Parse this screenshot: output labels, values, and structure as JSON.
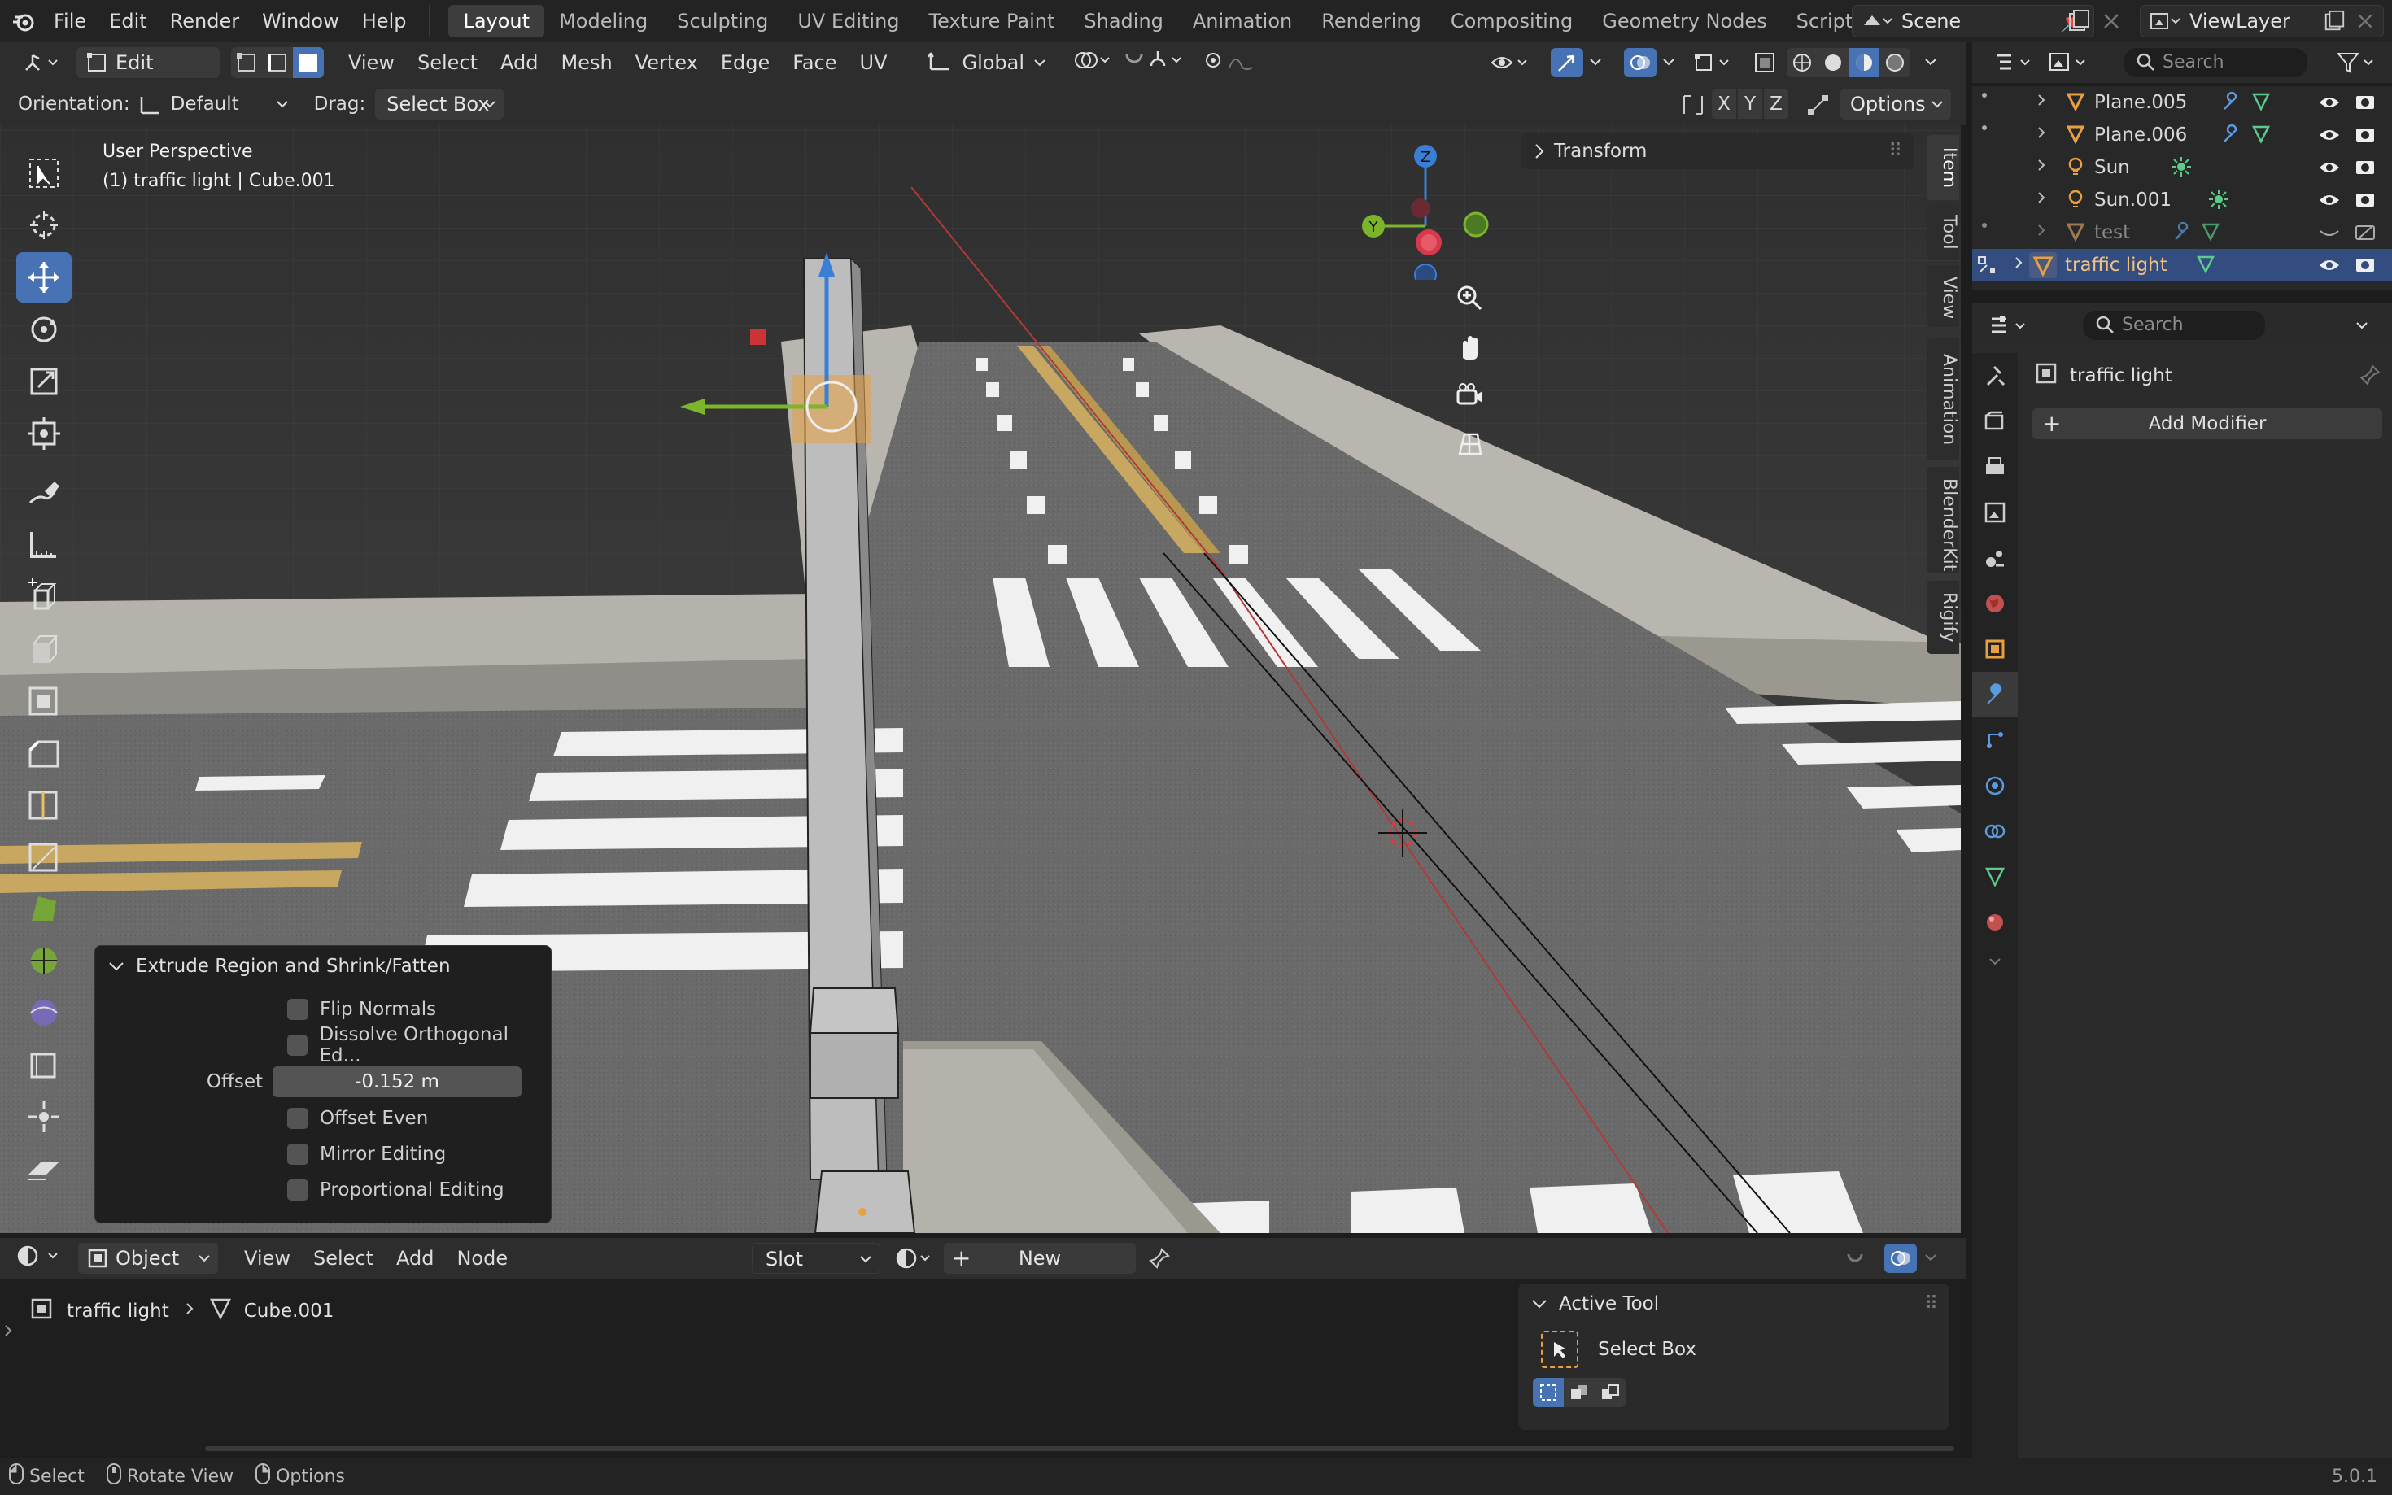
{
  "topbar": {
    "menus": [
      "File",
      "Edit",
      "Render",
      "Window",
      "Help"
    ],
    "workspaces": [
      "Layout",
      "Modeling",
      "Sculpting",
      "UV Editing",
      "Texture Paint",
      "Shading",
      "Animation",
      "Rendering",
      "Compositing",
      "Geometry Nodes",
      "Scripting"
    ],
    "active_workspace": "Layout",
    "add_label": "+",
    "scene": "Scene",
    "view_layer": "ViewLayer"
  },
  "viewport_header": {
    "mode": "Edit Mode",
    "menus": [
      "View",
      "Select",
      "Add",
      "Mesh",
      "Vertex",
      "Edge",
      "Face",
      "UV"
    ],
    "transform_orientation": "Global",
    "orientation_label": "Orientation:",
    "orientation_value": "Default",
    "drag_label": "Drag:",
    "drag_value": "Select Box",
    "axes": [
      "X",
      "Y",
      "Z"
    ],
    "options": "Options"
  },
  "viewport": {
    "perspective": "User Perspective",
    "object_info": "(1) traffic light | Cube.001",
    "transform_panel": "Transform",
    "gizmo_axes": {
      "z": "Z",
      "y": "Y",
      "x": "X"
    },
    "side_tabs": [
      "Item",
      "Tool",
      "View",
      "Animation",
      "BlenderKit",
      "Rigify"
    ]
  },
  "operator_panel": {
    "title": "Extrude Region and Shrink/Fatten",
    "flip_normals": "Flip Normals",
    "dissolve": "Dissolve Orthogonal Ed...",
    "offset_label": "Offset",
    "offset_value": "-0.152 m",
    "offset_even": "Offset Even",
    "mirror_editing": "Mirror Editing",
    "proportional_editing": "Proportional Editing"
  },
  "outliner": {
    "search_placeholder": "Search",
    "items": [
      {
        "name": "Plane.005",
        "type": "mesh"
      },
      {
        "name": "Plane.006",
        "type": "mesh"
      },
      {
        "name": "Sun",
        "type": "light"
      },
      {
        "name": "Sun.001",
        "type": "light"
      },
      {
        "name": "test",
        "type": "mesh"
      },
      {
        "name": "traffic light",
        "type": "mesh",
        "selected": true
      }
    ]
  },
  "properties": {
    "search_placeholder": "Search",
    "object_name": "traffic light",
    "add_modifier": "Add Modifier"
  },
  "shader_editor": {
    "object_type": "Object",
    "menus": [
      "View",
      "Select",
      "Add",
      "Node"
    ],
    "slot": "Slot",
    "new_label": "New",
    "breadcrumb_object": "traffic light",
    "breadcrumb_mesh": "Cube.001"
  },
  "active_tool": {
    "title": "Active Tool",
    "tool_name": "Select Box"
  },
  "status_bar": {
    "select": "Select",
    "rotate": "Rotate View",
    "options": "Options",
    "version": "5.0.1"
  },
  "colors": {
    "accent": "#4772b3",
    "selection_orange": "#e8a040",
    "axis_x": "#d63a4a",
    "axis_y": "#7ab52c",
    "axis_z": "#3a7ed6"
  }
}
